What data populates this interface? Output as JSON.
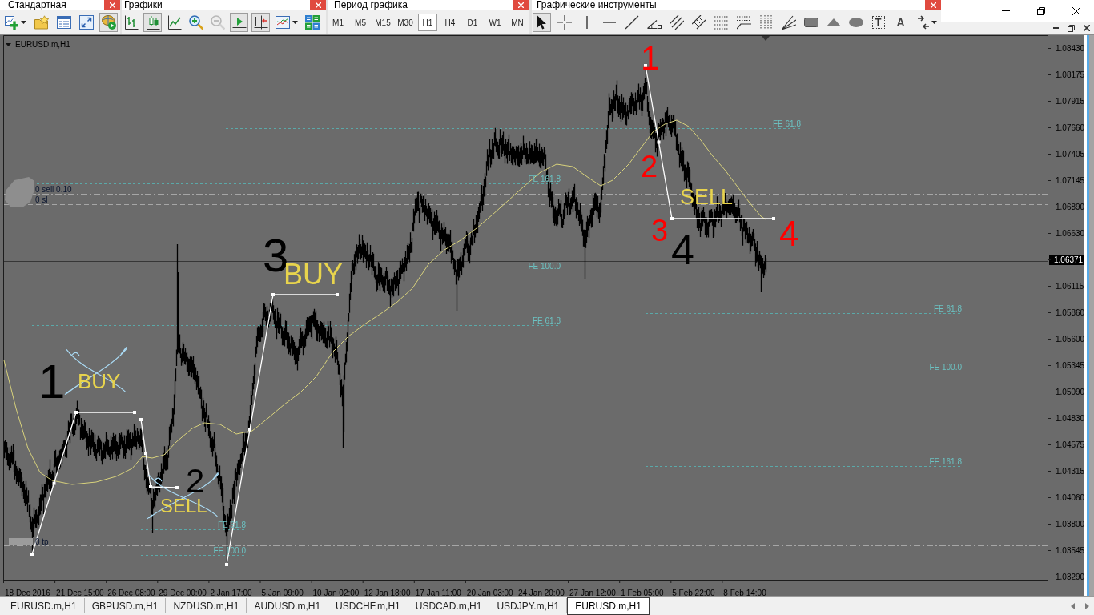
{
  "toolbars": [
    {
      "kind": "standard",
      "title": "Стандартная",
      "buttons": [
        {
          "kind": "newchart",
          "on": false
        },
        {
          "kind": "profiles",
          "on": false
        },
        {
          "kind": "navigator",
          "on": false
        },
        {
          "kind": "fullscreen",
          "on": false
        },
        {
          "kind": "market",
          "on": true
        }
      ]
    },
    {
      "kind": "charts",
      "title": "Графики",
      "buttons": [
        {
          "kind": "bars",
          "on": false,
          "disabled": false
        },
        {
          "kind": "candles",
          "on": true,
          "disabled": false
        },
        {
          "kind": "line",
          "on": false,
          "disabled": false
        },
        {
          "kind": "zoomin",
          "on": false,
          "disabled": false
        },
        {
          "kind": "zoomout",
          "on": false,
          "disabled": true
        },
        {
          "kind": "autoscroll",
          "on": true,
          "disabled": false
        },
        {
          "kind": "shift",
          "on": true,
          "disabled": false
        },
        {
          "kind": "indicators",
          "on": false,
          "disabled": false
        },
        {
          "kind": "tile",
          "on": false,
          "disabled": false
        }
      ]
    },
    {
      "kind": "periods",
      "title": "Период графика",
      "periods": [
        {
          "label": "M1",
          "selected": false
        },
        {
          "label": "M5",
          "selected": false
        },
        {
          "label": "M15",
          "selected": false
        },
        {
          "label": "M30",
          "selected": false
        },
        {
          "label": "H1",
          "selected": true
        },
        {
          "label": "H4",
          "selected": false
        },
        {
          "label": "D1",
          "selected": false
        },
        {
          "label": "W1",
          "selected": false
        },
        {
          "label": "MN",
          "selected": false
        }
      ]
    },
    {
      "kind": "tools",
      "title": "Графические инструменты",
      "buttons": [
        {
          "kind": "cursor",
          "selected": true
        },
        {
          "kind": "crosshair",
          "selected": false
        },
        {
          "kind": "vline",
          "selected": false
        },
        {
          "kind": "hline",
          "selected": false
        },
        {
          "kind": "trendline",
          "selected": false
        },
        {
          "kind": "angle",
          "selected": false
        },
        {
          "kind": "channel",
          "selected": false
        },
        {
          "kind": "fibochannel",
          "selected": false
        },
        {
          "kind": "fibo",
          "selected": false
        },
        {
          "kind": "fiboexp",
          "selected": false
        },
        {
          "kind": "fibotime",
          "selected": false
        },
        {
          "kind": "fan",
          "selected": false
        },
        {
          "kind": "rectangle",
          "selected": false
        },
        {
          "kind": "triangle",
          "selected": false
        },
        {
          "kind": "ellipse",
          "selected": false
        },
        {
          "kind": "text",
          "glyph": "T",
          "selected": false
        },
        {
          "kind": "label",
          "glyph": "A",
          "selected": false
        },
        {
          "kind": "arrows",
          "selected": false
        }
      ]
    }
  ],
  "chart": {
    "title": "EURUSD.m,H1",
    "price_labels": [
      {
        "text": "1.08430",
        "kind": "tick"
      },
      {
        "text": "1.08175",
        "kind": "tick"
      },
      {
        "text": "1.07915",
        "kind": "tick"
      },
      {
        "text": "1.07660",
        "kind": "tick"
      },
      {
        "text": "1.07405",
        "kind": "tick"
      },
      {
        "text": "1.07145",
        "kind": "tick"
      },
      {
        "text": "1.06890",
        "kind": "tick"
      },
      {
        "text": "1.06630",
        "kind": "tick"
      },
      {
        "text": "1.06371",
        "kind": "current"
      },
      {
        "text": "1.06115",
        "kind": "tick"
      },
      {
        "text": "1.05860",
        "kind": "tick"
      },
      {
        "text": "1.05600",
        "kind": "tick"
      },
      {
        "text": "1.05345",
        "kind": "tick"
      },
      {
        "text": "1.05090",
        "kind": "tick"
      },
      {
        "text": "1.04830",
        "kind": "tick"
      },
      {
        "text": "1.04575",
        "kind": "tick"
      },
      {
        "text": "1.04315",
        "kind": "tick"
      },
      {
        "text": "1.04060",
        "kind": "tick"
      },
      {
        "text": "1.03800",
        "kind": "tick"
      },
      {
        "text": "1.03545",
        "kind": "tick"
      },
      {
        "text": "1.03290",
        "kind": "tick"
      }
    ],
    "time_labels": [
      "18 Dec 2016",
      "21 Dec 15:00",
      "26 Dec 08:00",
      "29 Dec 00:00",
      "2 Jan 17:00",
      "5 Jan 09:00",
      "10 Jan 02:00",
      "12 Jan 18:00",
      "17 Jan 11:00",
      "20 Jan 03:00",
      "24 Jan 20:00",
      "27 Jan 12:00",
      "1 Feb 05:00",
      "5 Feb 22:00",
      "8 Feb 14:00"
    ],
    "order_lines": [
      {
        "kind": "sell",
        "label": "0 sell 0.10"
      },
      {
        "kind": "sl",
        "label": "0 sl"
      },
      {
        "kind": "tp",
        "label": "0 tp"
      }
    ],
    "fibo_expansions": [
      {
        "levels": [
          "FE 161.8",
          "FE 100.0",
          "FE 61.8"
        ]
      },
      {
        "levels": [
          "FE 61.8",
          "FE 100.0"
        ]
      },
      {
        "levels": [
          "FE 61.8"
        ]
      },
      {
        "levels": [
          "FE 61.8",
          "FE 100.0",
          "FE 161.8"
        ]
      }
    ],
    "annotations": [
      {
        "text": "1",
        "color": "#000000",
        "crossed": false
      },
      {
        "text": "BUY",
        "color": "#e8d44d",
        "crossed": true
      },
      {
        "text": "2",
        "color": "#000000",
        "crossed": false
      },
      {
        "text": "SELL",
        "color": "#e8d44d",
        "crossed": true
      },
      {
        "text": "3",
        "color": "#000000",
        "crossed": false
      },
      {
        "text": "BUY",
        "color": "#e8d44d",
        "crossed": false
      },
      {
        "text": "1",
        "color": "#ff0000",
        "crossed": false
      },
      {
        "text": "2",
        "color": "#ff0000",
        "crossed": false
      },
      {
        "text": "3",
        "color": "#ff0000",
        "crossed": false
      },
      {
        "text": "4",
        "color": "#000000",
        "crossed": false
      },
      {
        "text": "4",
        "color": "#ff0000",
        "crossed": false
      },
      {
        "text": "SELL",
        "color": "#e8d44d",
        "crossed": false
      }
    ]
  },
  "tabs": [
    {
      "label": "EURUSD.m,H1",
      "selected": false
    },
    {
      "label": "GBPUSD.m,H1",
      "selected": false
    },
    {
      "label": "NZDUSD.m,H1",
      "selected": false
    },
    {
      "label": "AUDUSD.m,H1",
      "selected": false
    },
    {
      "label": "USDCHF.m,H1",
      "selected": false
    },
    {
      "label": "USDCAD.m,H1",
      "selected": false
    },
    {
      "label": "USDJPY.m,H1",
      "selected": false
    },
    {
      "label": "EURUSD.m,H1",
      "selected": true
    }
  ]
}
